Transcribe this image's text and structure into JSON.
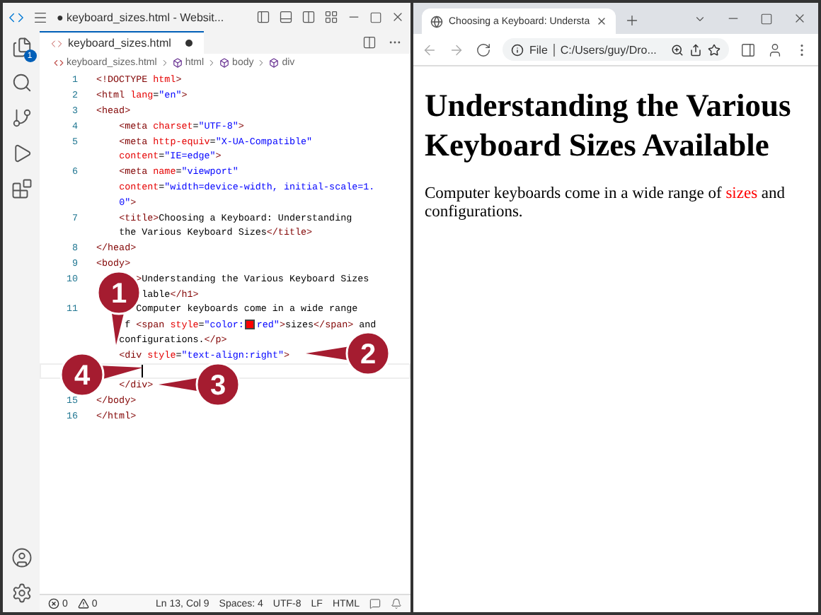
{
  "vscode": {
    "title": "● keyboard_sizes.html - Websit...",
    "explorer_badge": "1",
    "tab": {
      "label": "keyboard_sizes.html",
      "modified": true
    },
    "breadcrumb": [
      {
        "kind": "file",
        "label": "keyboard_sizes.html"
      },
      {
        "kind": "symbol",
        "label": "html"
      },
      {
        "kind": "symbol",
        "label": "body"
      },
      {
        "kind": "symbol",
        "label": "div"
      }
    ],
    "code": [
      {
        "number": "1",
        "text": "<!DOCTYPE html>"
      },
      {
        "number": "2",
        "text": "<html lang=\"en\">"
      },
      {
        "number": "3",
        "text": "<head>"
      },
      {
        "number": "4",
        "text": "    <meta charset=\"UTF-8\">"
      },
      {
        "number": "5",
        "text": "    <meta http-equiv=\"X-UA-Compatible\""
      },
      {
        "text": "    content=\"IE=edge\">"
      },
      {
        "number": "6",
        "text": "    <meta name=\"viewport\""
      },
      {
        "text": "    content=\"width=device-width, initial-scale=1."
      },
      {
        "text": "    0\">"
      },
      {
        "number": "7",
        "text": "    <title>Choosing a Keyboard: Understanding"
      },
      {
        "text": "    the Various Keyboard Sizes</title>"
      },
      {
        "number": "8",
        "text": "</head>"
      },
      {
        "number": "9",
        "text": "<body>"
      },
      {
        "number": "10",
        "text": "       >Understanding the Various Keyboard Sizes"
      },
      {
        "text": "        lable</h1>"
      },
      {
        "number": "11",
        "text": "       Computer keyboards come in a wide range"
      },
      {
        "text": "     f <span style=\"color:",
        "color": "#ff0000",
        "text_after": "red\">sizes</span> and"
      },
      {
        "text": "    configurations.</p>"
      },
      {
        "text": "    <div style=\"text-align:right\">"
      },
      {
        "current": true
      },
      {
        "text": "    </div>"
      },
      {
        "number": "15",
        "text": "</body>"
      },
      {
        "number": "16",
        "text": "</html>"
      }
    ],
    "status_left": [
      {
        "kind": "errors",
        "text": "0"
      },
      {
        "kind": "warnings",
        "text": "0"
      }
    ],
    "status_right": [
      "Ln 13, Col 9",
      "Spaces: 4",
      "UTF-8",
      "LF",
      "HTML"
    ]
  },
  "callouts": [
    {
      "label": "1"
    },
    {
      "label": "2"
    },
    {
      "label": "3"
    },
    {
      "label": "4"
    }
  ],
  "browser": {
    "tab_title": "Choosing a Keyboard: Understa",
    "address_scheme": "File",
    "address": "C:/Users/guy/Dro...",
    "heading": "Understanding the Various Keyboard Sizes Available",
    "paragraph": [
      {
        "text": "Computer keyboards come in a wide range of "
      },
      {
        "text": "sizes",
        "color": "#ff0000"
      },
      {
        "text": " and configurations."
      }
    ]
  }
}
